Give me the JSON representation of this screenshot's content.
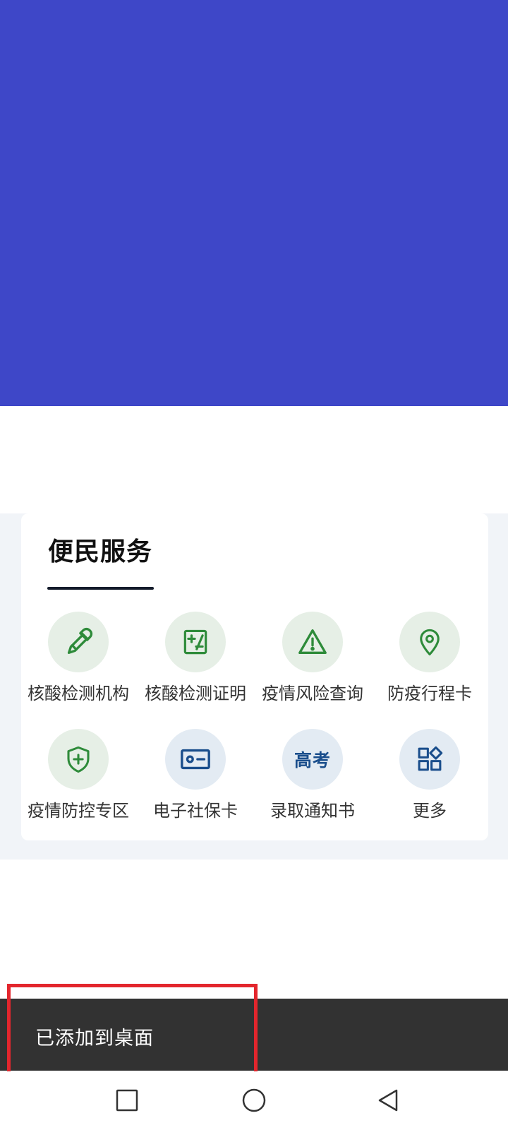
{
  "section": {
    "title": "便民服务"
  },
  "services": [
    {
      "label": "核酸检测机构",
      "icon": "dropper-icon"
    },
    {
      "label": "核酸检测证明",
      "icon": "test-certificate-icon"
    },
    {
      "label": "疫情风险查询",
      "icon": "warning-icon"
    },
    {
      "label": "防疫行程卡",
      "icon": "location-pin-icon"
    },
    {
      "label": "疫情防控专区",
      "icon": "shield-plus-icon"
    },
    {
      "label": "电子社保卡",
      "icon": "id-card-icon"
    },
    {
      "label": "录取通知书",
      "icon": "gaokao-icon",
      "icon_text": "高考"
    },
    {
      "label": "更多",
      "icon": "apps-grid-icon"
    }
  ],
  "toast": {
    "message": "已添加到桌面"
  },
  "colors": {
    "banner": "#3e47c8",
    "icon_green": "#2e8b3a",
    "icon_blue": "#1a4e8c",
    "toast_bg": "#323232",
    "highlight": "#e3262d"
  },
  "nav": [
    "recent-apps-icon",
    "home-icon",
    "back-icon"
  ]
}
